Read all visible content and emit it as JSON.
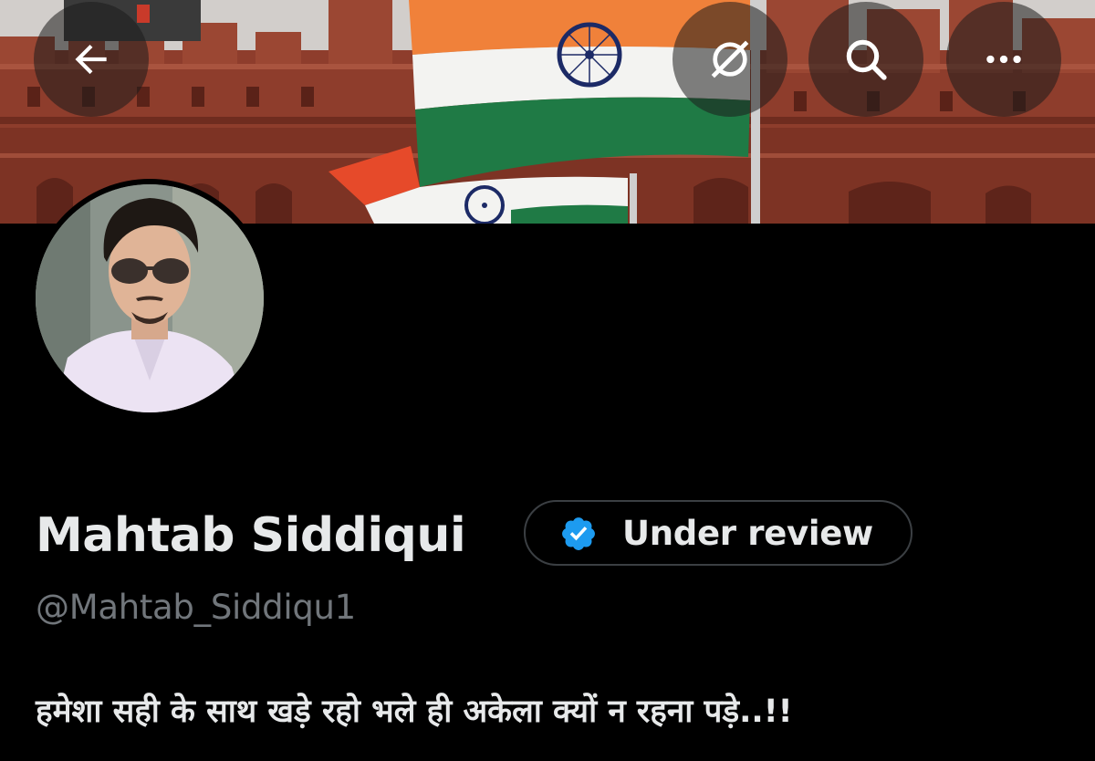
{
  "colors": {
    "background": "#000000",
    "primary_text": "#e7e9ea",
    "secondary_text": "#71767b",
    "verified_blue": "#1d9bf0",
    "pill_border": "#3b3f43"
  },
  "header": {
    "back_icon": "arrow-left-icon",
    "translate_icon": "translate-off-icon",
    "search_icon": "search-icon",
    "more_icon": "more-horizontal-icon"
  },
  "banner": {
    "description_icon": "banner-image"
  },
  "profile": {
    "display_name": "Mahtab Siddiqui",
    "verification_label": "Under review",
    "verification_icon": "verified-badge-icon",
    "handle": "@Mahtab_Siddiqu1",
    "bio": "हमेशा सही के साथ खड़े रहो भले ही अकेला क्यों न रहना पड़े..!!"
  }
}
